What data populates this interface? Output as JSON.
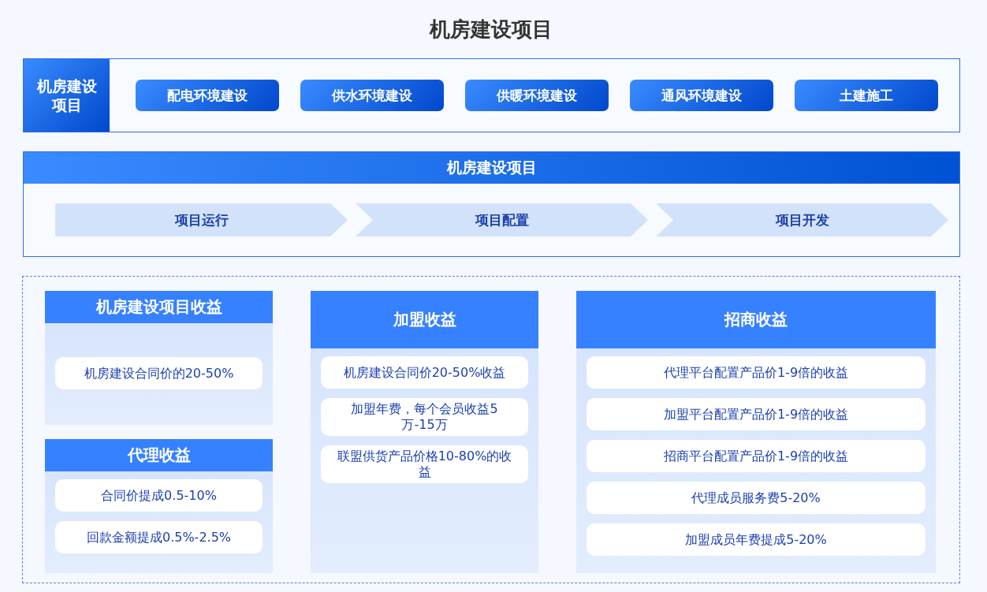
{
  "title": "机房建设项目",
  "top_panel": {
    "label": "机房建设项目",
    "buttons": [
      "配电环境建设",
      "供水环境建设",
      "供暖环境建设",
      "通风环境建设",
      "土建施工"
    ]
  },
  "process_panel": {
    "title": "机房建设项目",
    "steps": [
      "项目运行",
      "项目配置",
      "项目开发"
    ]
  },
  "revenue_columns": [
    {
      "cards": [
        {
          "title": "机房建设项目收益",
          "items": [
            "机房建设合同价的20-50%"
          ]
        },
        {
          "title": "代理收益",
          "items": [
            "合同价提成0.5-10%",
            "回款金额提成0.5%-2.5%"
          ]
        }
      ]
    },
    {
      "cards": [
        {
          "title": "加盟收益",
          "items": [
            "机房建设合同价20-50%收益",
            "加盟年费，每个会员收益5万-15万",
            "联盟供货产品价格10-80%的收益"
          ]
        }
      ]
    },
    {
      "cards": [
        {
          "title": "招商收益",
          "items": [
            "代理平台配置产品价1-9倍的收益",
            "加盟平台配置产品价1-9倍的收益",
            "招商平台配置产品价1-9倍的收益",
            "代理成员服务费5-20%",
            "加盟成员年费提成5-20%"
          ]
        }
      ]
    }
  ]
}
